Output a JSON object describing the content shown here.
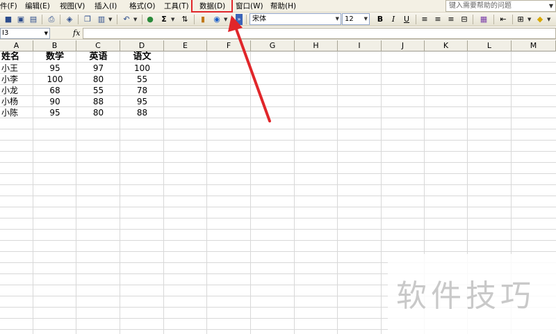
{
  "menu": {
    "items": [
      "件(F)",
      "编辑(E)",
      "视图(V)",
      "插入(I)",
      "格式(O)",
      "工具(T)",
      "数据(D)",
      "窗口(W)",
      "帮助(H)"
    ],
    "help_placeholder": "键入需要帮助的问题"
  },
  "toolbar": {
    "font_name": "宋体",
    "font_size": "12",
    "sigma_label": "Σ",
    "bold_label": "B",
    "italic_label": "I",
    "underline_label": "U"
  },
  "formula_bar": {
    "name_box": "I3",
    "fx_label": "fx",
    "formula": ""
  },
  "grid": {
    "columns": [
      "A",
      "B",
      "C",
      "D",
      "E",
      "F",
      "G",
      "H",
      "I",
      "J",
      "K",
      "L",
      "M"
    ],
    "headers": [
      "姓名",
      "数学",
      "英语",
      "语文"
    ],
    "rows": [
      [
        "小王",
        "95",
        "97",
        "100"
      ],
      [
        "小李",
        "100",
        "80",
        "55"
      ],
      [
        "小龙",
        "68",
        "55",
        "78"
      ],
      [
        "小杨",
        "90",
        "88",
        "95"
      ],
      [
        "小陈",
        "95",
        "80",
        "88"
      ]
    ]
  },
  "annotation": {
    "highlight_color": "#e0262a"
  },
  "watermark": {
    "text": "软件技巧"
  }
}
